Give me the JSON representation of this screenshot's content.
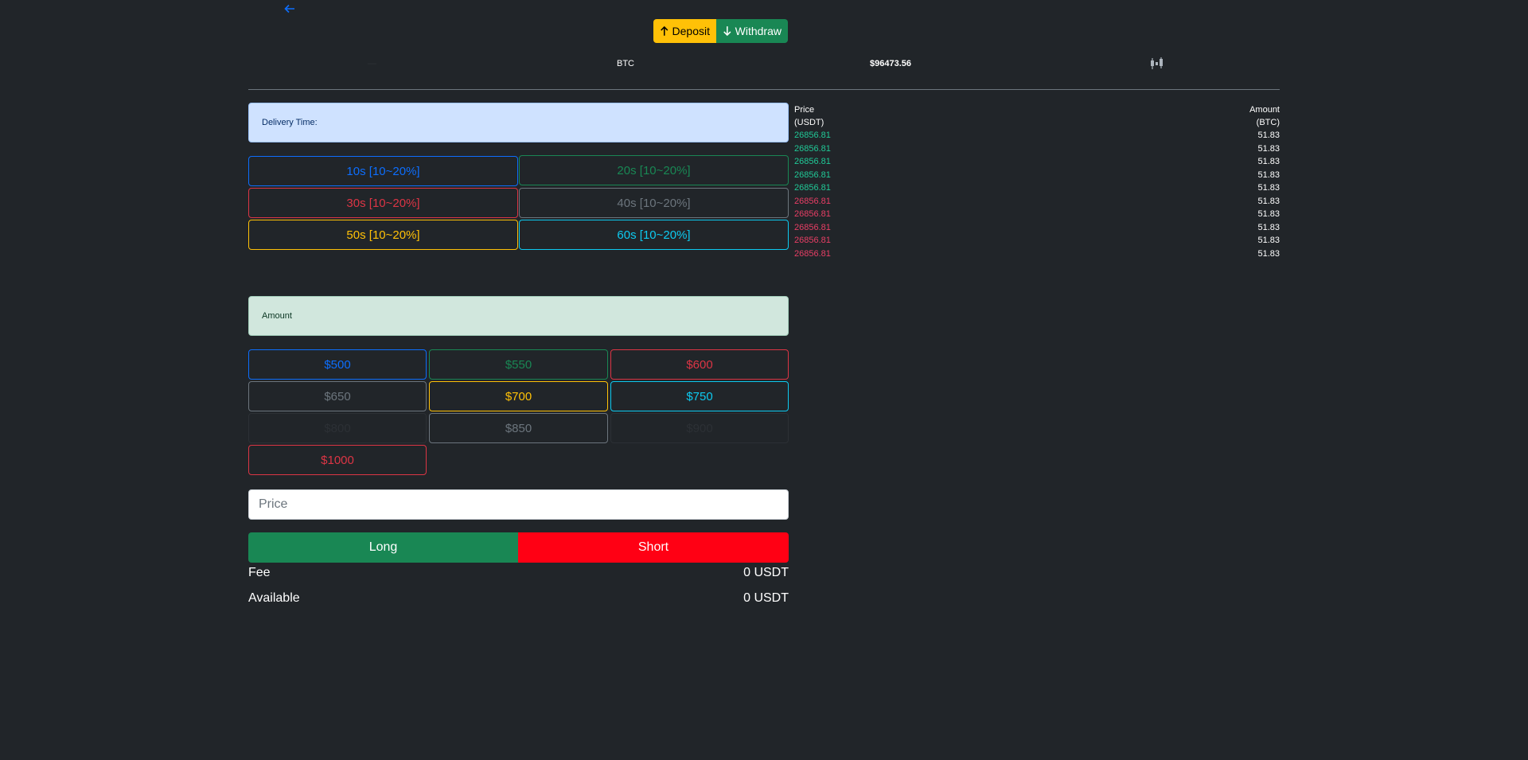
{
  "nav": {
    "back_icon": "arrow-left-icon"
  },
  "actions": {
    "deposit_label": "Deposit",
    "withdraw_label": "Withdraw"
  },
  "ticker": {
    "ghost_text": "—",
    "symbol": "BTC",
    "price": "$96473.56",
    "chart_icon": "candlestick-icon"
  },
  "delivery": {
    "label": "Delivery Time:",
    "options": [
      {
        "label": "10s [10~20%]",
        "color": "#0d6efd"
      },
      {
        "label": "20s [10~20%]",
        "color": "#198754"
      },
      {
        "label": "30s [10~20%]",
        "color": "#dc3545"
      },
      {
        "label": "40s [10~20%]",
        "color": "#6c757d"
      },
      {
        "label": "50s [10~20%]",
        "color": "#ffc107"
      },
      {
        "label": "60s [10~20%]",
        "color": "#0dcaf0"
      }
    ]
  },
  "amount": {
    "label": "Amount",
    "options": [
      {
        "label": "$500",
        "color": "#0d6efd"
      },
      {
        "label": "$550",
        "color": "#198754"
      },
      {
        "label": "$600",
        "color": "#dc3545"
      },
      {
        "label": "$650",
        "color": "#6c757d"
      },
      {
        "label": "$700",
        "color": "#ffc107"
      },
      {
        "label": "$750",
        "color": "#0dcaf0"
      },
      {
        "label": "$800",
        "color": "#2c3035"
      },
      {
        "label": "$850",
        "color": "#6c757d"
      },
      {
        "label": "$900",
        "color": "#2c3035"
      },
      {
        "label": "$1000",
        "color": "#dc3545"
      }
    ]
  },
  "form": {
    "price_placeholder": "Price",
    "long_label": "Long",
    "short_label": "Short"
  },
  "summary": {
    "fee_label": "Fee",
    "fee_value": "0 USDT",
    "available_label": "Available",
    "available_value": "0 USDT"
  },
  "orderbook": {
    "price_header": "Price",
    "price_unit": "(USDT)",
    "amount_header": "Amount",
    "amount_unit": "(BTC)",
    "rows": [
      {
        "price": "26856.81",
        "amount": "51.83",
        "side": "buy"
      },
      {
        "price": "26856.81",
        "amount": "51.83",
        "side": "buy"
      },
      {
        "price": "26856.81",
        "amount": "51.83",
        "side": "buy"
      },
      {
        "price": "26856.81",
        "amount": "51.83",
        "side": "buy"
      },
      {
        "price": "26856.81",
        "amount": "51.83",
        "side": "buy"
      },
      {
        "price": "26856.81",
        "amount": "51.83",
        "side": "sell"
      },
      {
        "price": "26856.81",
        "amount": "51.83",
        "side": "sell"
      },
      {
        "price": "26856.81",
        "amount": "51.83",
        "side": "sell"
      },
      {
        "price": "26856.81",
        "amount": "51.83",
        "side": "sell"
      },
      {
        "price": "26856.81",
        "amount": "51.83",
        "side": "sell"
      }
    ],
    "buy_color": "#20c997",
    "sell_color": "#e83e65"
  }
}
